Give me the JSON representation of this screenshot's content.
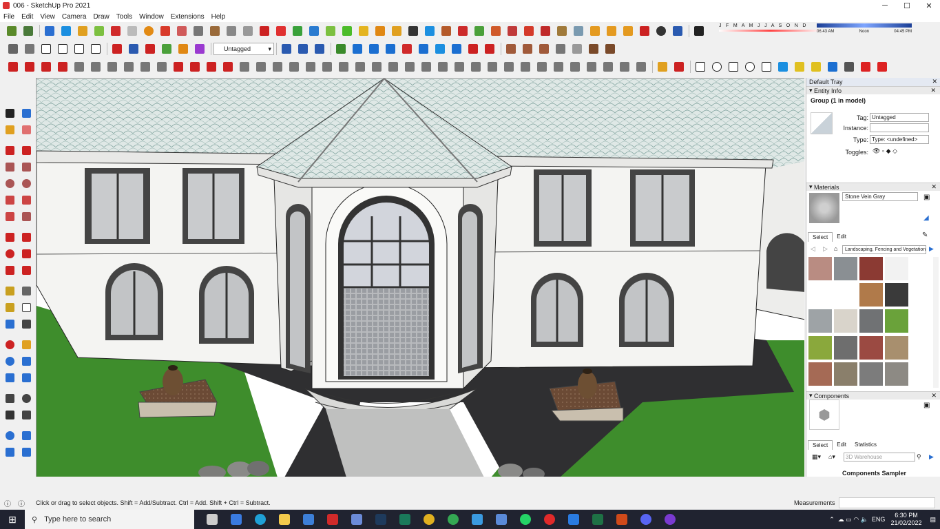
{
  "window": {
    "title": "006 - SketchUp Pro 2021",
    "minimize": "─",
    "maximize": "☐",
    "close": "✕"
  },
  "menu": [
    "File",
    "Edit",
    "View",
    "Camera",
    "Draw",
    "Tools",
    "Window",
    "Extensions",
    "Help"
  ],
  "toolbar": {
    "tag_value": "Untagged",
    "shadow_months": "J F M A M J J A S O N D",
    "shadow_time_start": "06:43 AM",
    "shadow_time_mid": "Noon",
    "shadow_time_end": "04:45 PM"
  },
  "tray": {
    "title": "Default Tray",
    "entity_info": {
      "header": "Entity Info",
      "selection": "Group (1 in model)",
      "tag_label": "Tag:",
      "tag_value": "Untagged",
      "instance_label": "Instance:",
      "instance_value": "",
      "type_label": "Type:",
      "type_value": "Type: <undefined>",
      "toggles_label": "Toggles:"
    },
    "materials": {
      "header": "Materials",
      "current": "Stone Vein Gray",
      "tab_select": "Select",
      "tab_edit": "Edit",
      "library": "Landscaping, Fencing and Vegetation",
      "swatch_colors": [
        "#b98c82",
        "#8a8f93",
        "#8b3a33",
        "#f2f2f2",
        "#ffffff",
        "#ffffff",
        "#b07a4a",
        "#3a3a3a",
        "#9ea3a6",
        "#d9d4cb",
        "#707274",
        "#6aa23a",
        "#8aa83c",
        "#6e6e6e",
        "#9b4a42",
        "#a88f6e",
        "#a56a55",
        "#8a7f6b",
        "#7c7c7c",
        "#8d8a84"
      ]
    },
    "components": {
      "header": "Components",
      "tab_select": "Select",
      "tab_edit": "Edit",
      "tab_statistics": "Statistics",
      "search_placeholder": "3D Warehouse",
      "sampler": "Components Sampler"
    }
  },
  "status": {
    "hint": "Click or drag to select objects. Shift = Add/Subtract. Ctrl = Add. Shift + Ctrl = Subtract.",
    "measurements_label": "Measurements",
    "measurements_value": ""
  },
  "taskbar": {
    "search_placeholder": "Type here to search",
    "language": "ENG",
    "time": "6:30 PM",
    "date": "21/02/2022"
  }
}
